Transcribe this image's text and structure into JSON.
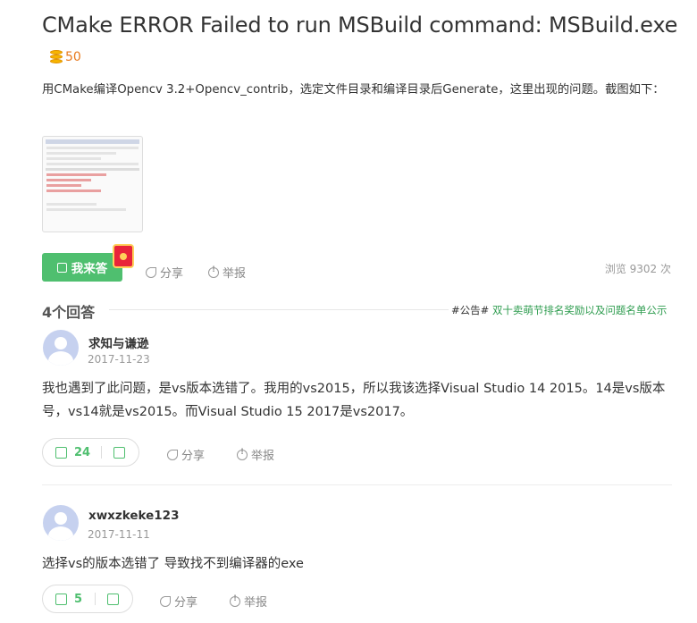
{
  "question": {
    "title": "CMake ERROR Failed to run MSBuild command: MSBuild.exe",
    "bounty": "50",
    "description": "用CMake编译Opencv 3.2+Opencv_contrib，选定文件目录和编译目录后Generate，这里出现的问题。截图如下：",
    "answer_button": "我来答",
    "share": "分享",
    "report": "举报",
    "views": "浏览 9302 次"
  },
  "answers_section": {
    "count_label": "4个回答",
    "notice_tag": "#公告#",
    "notice_text": "双十卖萌节排名奖励以及问题名单公示"
  },
  "answers": [
    {
      "user": "求知与谦逊",
      "date": "2017-11-23",
      "text": "我也遇到了此问题，是vs版本选错了。我用的vs2015，所以我该选择Visual Studio 14 2015。14是vs版本号，vs14就是vs2015。而Visual Studio 15 2017是vs2017。",
      "votes": "24",
      "share": "分享",
      "report": "举报"
    },
    {
      "user": "xwxzkeke123",
      "date": "2017-11-11",
      "text": "选择vs的版本选错了 导致找不到编译器的exe",
      "votes": "5",
      "share": "分享",
      "report": "举报"
    }
  ],
  "icons": {
    "bounty": "coin-stack-icon",
    "answer": "pen-icon",
    "redpack": "red-envelope-icon",
    "share": "share-icon",
    "report": "report-icon",
    "like": "thumbs-up-icon",
    "dislike": "thumbs-down-icon",
    "avatar": "default-avatar-icon"
  },
  "colors": {
    "accent_green": "#4fbf6f",
    "bounty_orange": "#e87a1e",
    "notice_green": "#2e9c4f",
    "avatar_blue": "#c6d1ef"
  }
}
